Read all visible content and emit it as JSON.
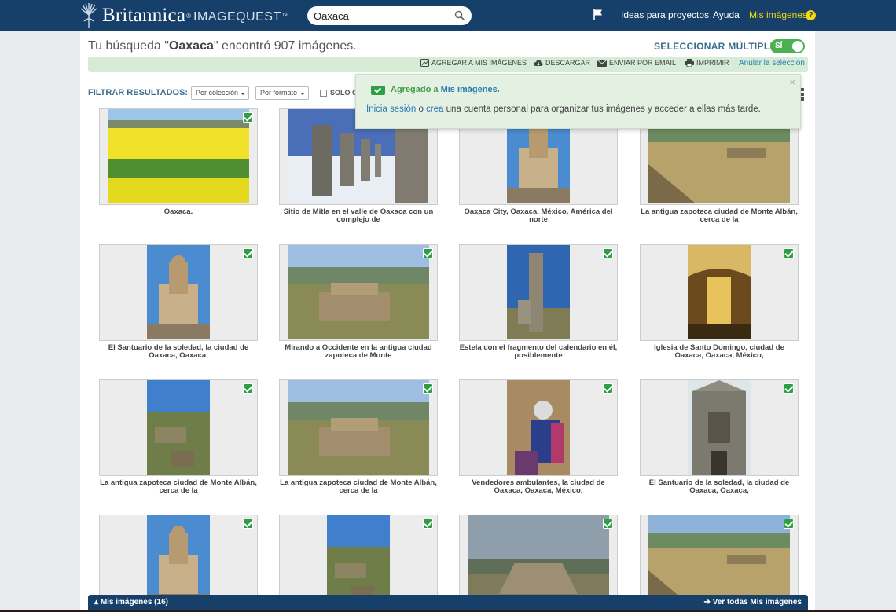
{
  "header": {
    "brand_name": "Britannica",
    "brand_reg": "®",
    "brand_product": "IMAGEQUEST",
    "brand_tm": "™",
    "search_value": "Oaxaca",
    "nav_ideas": "Ideas para proyectos",
    "nav_help": "Ayuda",
    "nav_my_images": "Mis imágenes",
    "nav_question": "?"
  },
  "results": {
    "prefix": "Tu búsqueda \"",
    "query": "Oaxaca",
    "suffix": "\" encontró 907 imágenes."
  },
  "multi_select": {
    "label": "SELECCIONAR MÚLTIPLES",
    "toggle_text": "SÍ",
    "enabled": true
  },
  "actions": {
    "add": "AGREGAR A MIS IMÁGENES",
    "download": "DESCARGAR",
    "email": "ENVIAR POR EMAIL",
    "print": "IMPRIMIR",
    "cancel": "Anular la selección"
  },
  "filters": {
    "label": "FILTRAR RESULTADOS:",
    "collection": "Por colección",
    "format": "Por formato",
    "only_prefix": "SOLO C"
  },
  "popup": {
    "added_prefix": "Agregado a ",
    "added_link": "Mis imágenes.",
    "close": "×",
    "login_link": "Inicia sesión",
    "or_text": " o ",
    "create_link": "crea",
    "message_rest": " una cuenta personal para organizar tus imágenes y acceder a ellas más tarde."
  },
  "tiles": [
    {
      "caption": "Oaxaca.",
      "selected": true,
      "scene": "field"
    },
    {
      "caption": "Sitio de Mitla en el valle de Oaxaca con un complejo de",
      "selected": true,
      "scene": "columns"
    },
    {
      "caption": "Oaxaca City, Oaxaca, México, América del norte",
      "selected": true,
      "scene": "church"
    },
    {
      "caption": "La antigua zapoteca ciudad de Monte Albán, cerca de la",
      "selected": true,
      "scene": "plaza"
    },
    {
      "caption": "El Santuario de la soledad, la ciudad de Oaxaca, Oaxaca,",
      "selected": true,
      "scene": "church"
    },
    {
      "caption": "Mirando a Occidente en la antigua ciudad zapoteca de Monte",
      "selected": true,
      "scene": "ruins"
    },
    {
      "caption": "Estela con el fragmento del calendario en él, posiblemente",
      "selected": true,
      "scene": "stela"
    },
    {
      "caption": "Iglesia de Santo Domingo, ciudad de Oaxaca, Oaxaca, México,",
      "selected": true,
      "scene": "interior"
    },
    {
      "caption": "La antigua zapoteca ciudad de Monte Albán, cerca de la",
      "selected": true,
      "scene": "hill"
    },
    {
      "caption": "La antigua zapoteca ciudad de Monte Albán, cerca de la",
      "selected": true,
      "scene": "ruins"
    },
    {
      "caption": "Vendedores ambulantes, la ciudad de Oaxaca, Oaxaca, México,",
      "selected": true,
      "scene": "vendor"
    },
    {
      "caption": "El Santuario de la soledad, la ciudad de Oaxaca, Oaxaca,",
      "selected": true,
      "scene": "facade"
    },
    {
      "caption": "",
      "selected": true,
      "scene": "church"
    },
    {
      "caption": "",
      "selected": true,
      "scene": "hill"
    },
    {
      "caption": "",
      "selected": true,
      "scene": "pyramid"
    },
    {
      "caption": "",
      "selected": true,
      "scene": "plaza"
    }
  ],
  "bottom_bar": {
    "left": "Mis imágenes (16)",
    "right": "Ver todas Mis imágenes"
  },
  "colors": {
    "header_bg": "#16406a",
    "accent_green": "#2d9e43",
    "link_blue": "#2a7ab5",
    "my_images_yellow": "#f5d90a"
  }
}
